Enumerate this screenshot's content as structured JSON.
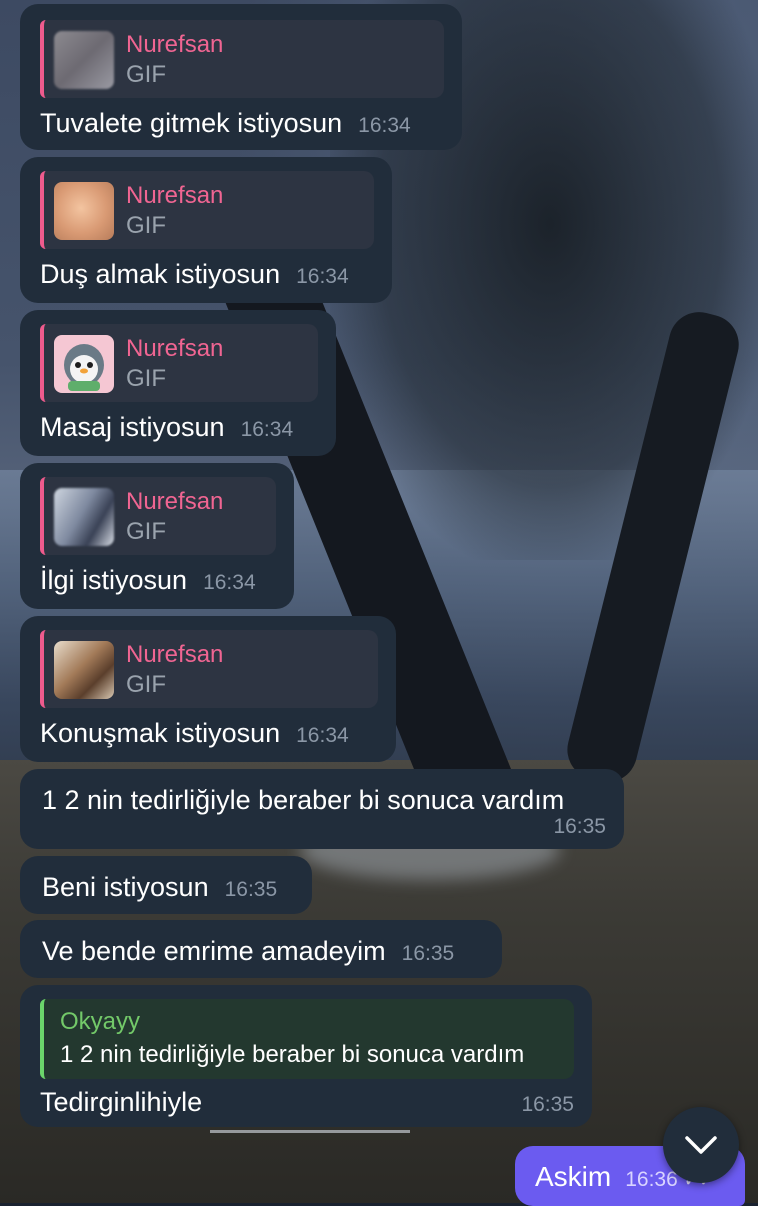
{
  "messages": [
    {
      "reply_author": "Nurefsan",
      "reply_kind": "GIF",
      "text": "Tuvalete gitmek istiyosun",
      "time": "16:34"
    },
    {
      "reply_author": "Nurefsan",
      "reply_kind": "GIF",
      "text": "Duş almak istiyosun",
      "time": "16:34"
    },
    {
      "reply_author": "Nurefsan",
      "reply_kind": "GIF",
      "text": "Masaj istiyosun",
      "time": "16:34"
    },
    {
      "reply_author": "Nurefsan",
      "reply_kind": "GIF",
      "text": "İlgi istiyosun",
      "time": "16:34"
    },
    {
      "reply_author": "Nurefsan",
      "reply_kind": "GIF",
      "text": "Konuşmak istiyosun",
      "time": "16:34"
    },
    {
      "text": "1 2 nin tedirliğiyle beraber bi sonuca vardım",
      "time": "16:35"
    },
    {
      "text": "Beni istiyosun",
      "time": "16:35"
    },
    {
      "text": "Ve bende emrime amadeyim",
      "time": "16:35"
    },
    {
      "reply_author": "Okyayy",
      "reply_quote": "1 2 nin tedirliğiyle beraber bi sonuca vardım",
      "text": "Tedirginlihiyle",
      "time": "16:35"
    }
  ],
  "outgoing": {
    "text": "Askim",
    "time": "16:36"
  },
  "colors": {
    "incoming_bubble": "#212d3b",
    "outgoing_bubble": "#6b5bf0",
    "reply_pink": "#f06592",
    "reply_green": "#73c969"
  }
}
